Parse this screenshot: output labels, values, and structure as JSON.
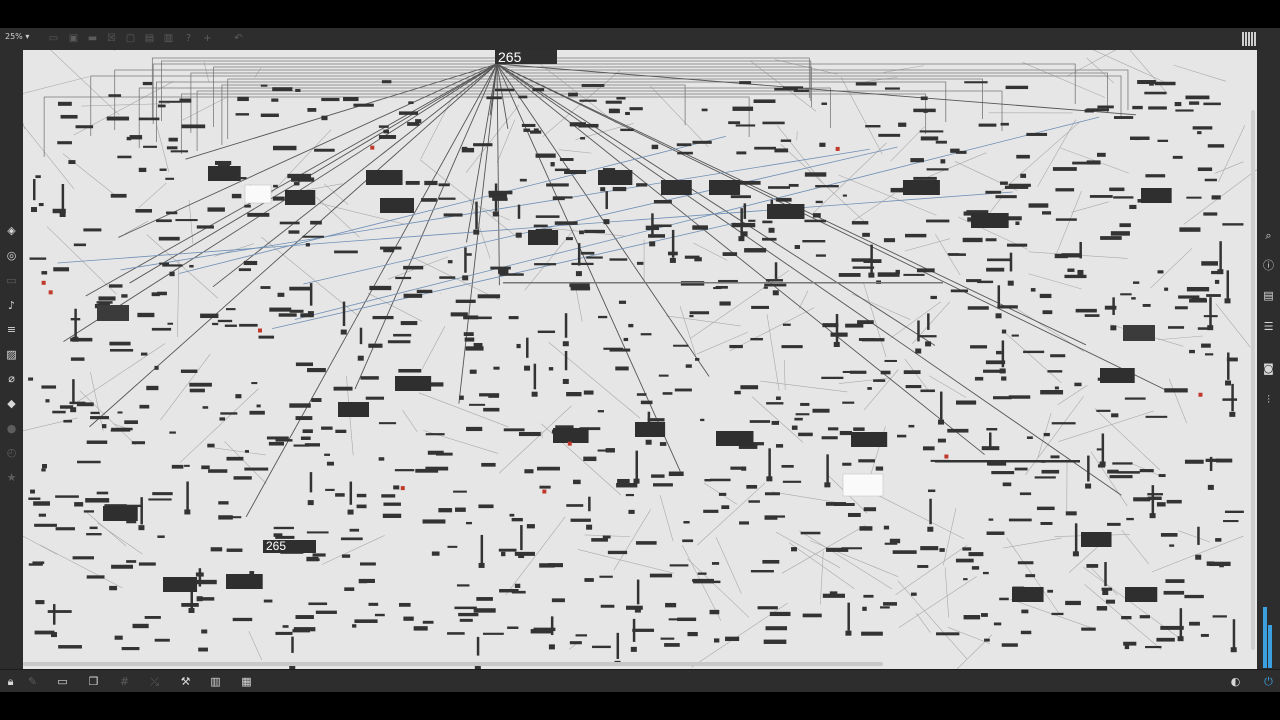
{
  "window": {
    "zoom_label": "25%"
  },
  "toolbar_top": {
    "icons": [
      "presentation-icon",
      "patcher-icon",
      "comment-icon",
      "close-box-icon",
      "object-box-icon",
      "inlet-icon",
      "outlet-icon",
      "help-icon",
      "add-icon",
      "undo-icon"
    ],
    "grid_icon": "grid-icon"
  },
  "sidebar_left": {
    "icons": [
      "package-icon",
      "target-icon",
      "window-icon",
      "music-note-icon",
      "sequence-icon",
      "image-icon",
      "paperclip-icon",
      "plug-icon",
      "info-circle-icon",
      "clock-icon",
      "star-icon"
    ]
  },
  "sidebar_right": {
    "icons": [
      "search-icon",
      "info-icon",
      "book-icon",
      "list-icon",
      "camera-icon",
      "mixer-icon"
    ]
  },
  "patch": {
    "number_boxes": [
      {
        "value": "265"
      },
      {
        "value": "265"
      }
    ],
    "colors": {
      "background": "#e6e6e6",
      "object": "#333333",
      "cable": "#555555",
      "signal_cable": "#6e8fb5",
      "accent": "#c0392b"
    }
  },
  "toolbar_bottom": {
    "icons": [
      "lock-icon",
      "edit-icon",
      "presentation-mode-icon",
      "windows-icon",
      "grid-snap-icon",
      "connect-icon",
      "wrench-icon",
      "keyboard-icon",
      "layout-icon",
      "metronome-icon",
      "power-icon"
    ]
  },
  "meter": {
    "levels": [
      0.85,
      0.6
    ]
  }
}
